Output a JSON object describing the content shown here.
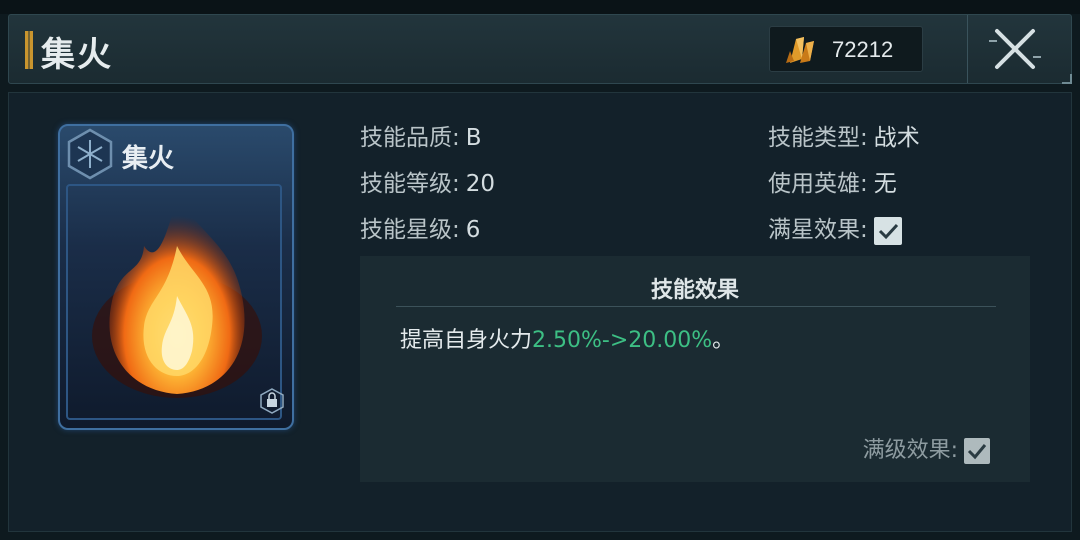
{
  "header": {
    "title": "集火",
    "currency_icon": "orange-crystal-icon",
    "currency_value": "72212",
    "close_icon": "close-x-icon"
  },
  "card": {
    "name": "集火",
    "emblem_icon": "hexagon-emblem-icon",
    "art": "fire-artwork",
    "lock_icon": "lock-icon"
  },
  "attributes": {
    "quality_label": "技能品质:",
    "quality_value": "B",
    "level_label": "技能等级:",
    "level_value": "20",
    "star_label": "技能星级:",
    "star_value": "6",
    "type_label": "技能类型:",
    "type_value": "战术",
    "hero_label": "使用英雄:",
    "hero_value": "无",
    "fullstar_label": "满星效果:",
    "fullstar_checked": true
  },
  "effect": {
    "title": "技能效果",
    "text_prefix": "提高自身火力",
    "text_highlight": "2.50%->20.00%",
    "text_suffix": "。",
    "maxlevel_label": "满级效果:",
    "maxlevel_checked": true
  },
  "colors": {
    "highlight": "#3dbf84",
    "accent_gold": "#c9952e",
    "card_border": "#3f6fa0"
  }
}
